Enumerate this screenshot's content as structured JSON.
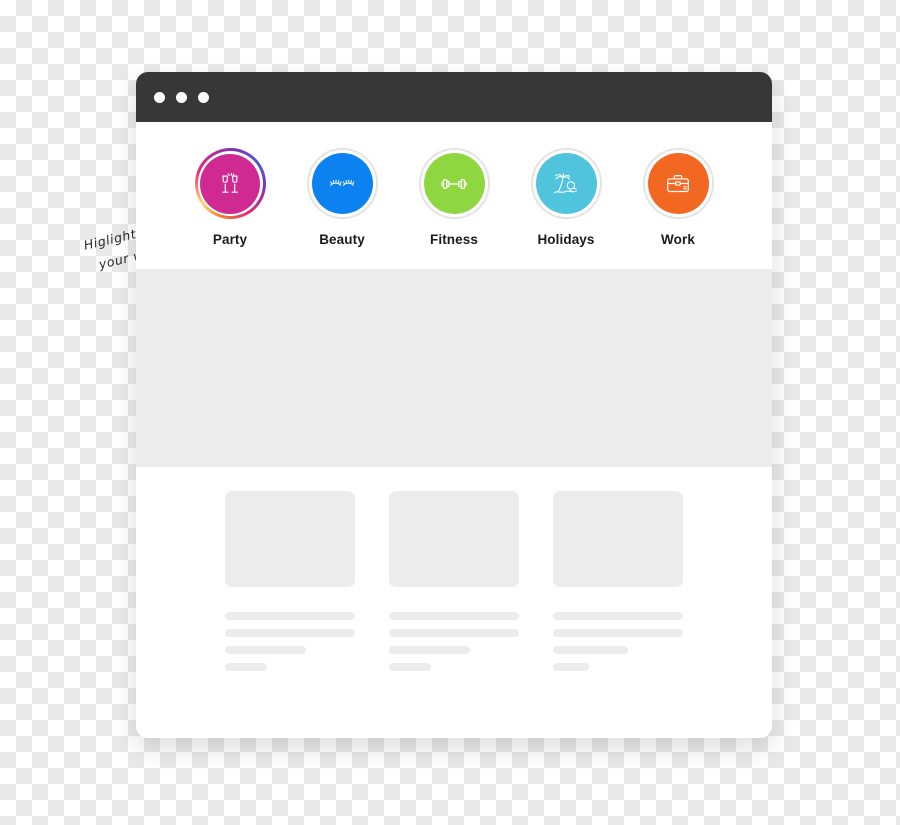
{
  "window": {
    "titlebar": {
      "dots": [
        "dot-1",
        "dot-2",
        "dot-3"
      ]
    }
  },
  "highlights": {
    "items": [
      {
        "label": "Party",
        "icon": "champagne-glasses-icon",
        "color": "#cf2a92",
        "active": true,
        "ring": "instagram-gradient"
      },
      {
        "label": "Beauty",
        "icon": "eyelashes-icon",
        "color": "#0c82f0",
        "active": false,
        "ring": "#e4e4e4"
      },
      {
        "label": "Fitness",
        "icon": "dumbbell-icon",
        "color": "#8fd741",
        "active": false,
        "ring": "#e4e4e4"
      },
      {
        "label": "Holidays",
        "icon": "palm-tree-sun-icon",
        "color": "#50c3dd",
        "active": false,
        "ring": "#e4e4e4"
      },
      {
        "label": "Work",
        "icon": "briefcase-icon",
        "color": "#f26722",
        "active": false,
        "ring": "#e4e4e4"
      }
    ]
  },
  "feed": {
    "cards": [
      {
        "line_widths": [
          "100%",
          "100%",
          "62%",
          "32%"
        ]
      },
      {
        "line_widths": [
          "100%",
          "100%",
          "62%",
          "32%"
        ]
      },
      {
        "line_widths": [
          "100%",
          "100%",
          "58%",
          "28%"
        ]
      }
    ]
  },
  "annotation": {
    "line1": "Higlights on",
    "line2": "your website",
    "arrow": "hand-drawn-arrow"
  },
  "colors": {
    "titlebar": "#373737",
    "page_background": "#ffffff",
    "grey_band": "#ececec",
    "placeholder": "#ececec",
    "label_text": "#1b1b1b"
  }
}
